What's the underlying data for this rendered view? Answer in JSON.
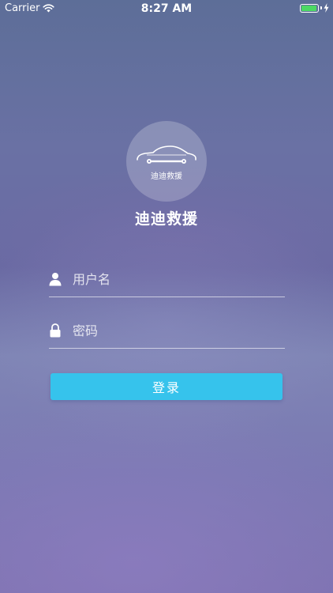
{
  "status_bar": {
    "carrier": "Carrier",
    "time": "8:27 AM",
    "battery_color": "#4cd964"
  },
  "logo": {
    "caption": "迪迪救援",
    "icon": "car-wrench-icon"
  },
  "app_title": "迪迪救援",
  "form": {
    "username": {
      "placeholder": "用户名",
      "value": "",
      "icon": "user-icon"
    },
    "password": {
      "placeholder": "密码",
      "value": "",
      "icon": "lock-icon"
    },
    "login_label": "登录"
  },
  "colors": {
    "button": "#36c3ec",
    "text": "#ffffff"
  }
}
